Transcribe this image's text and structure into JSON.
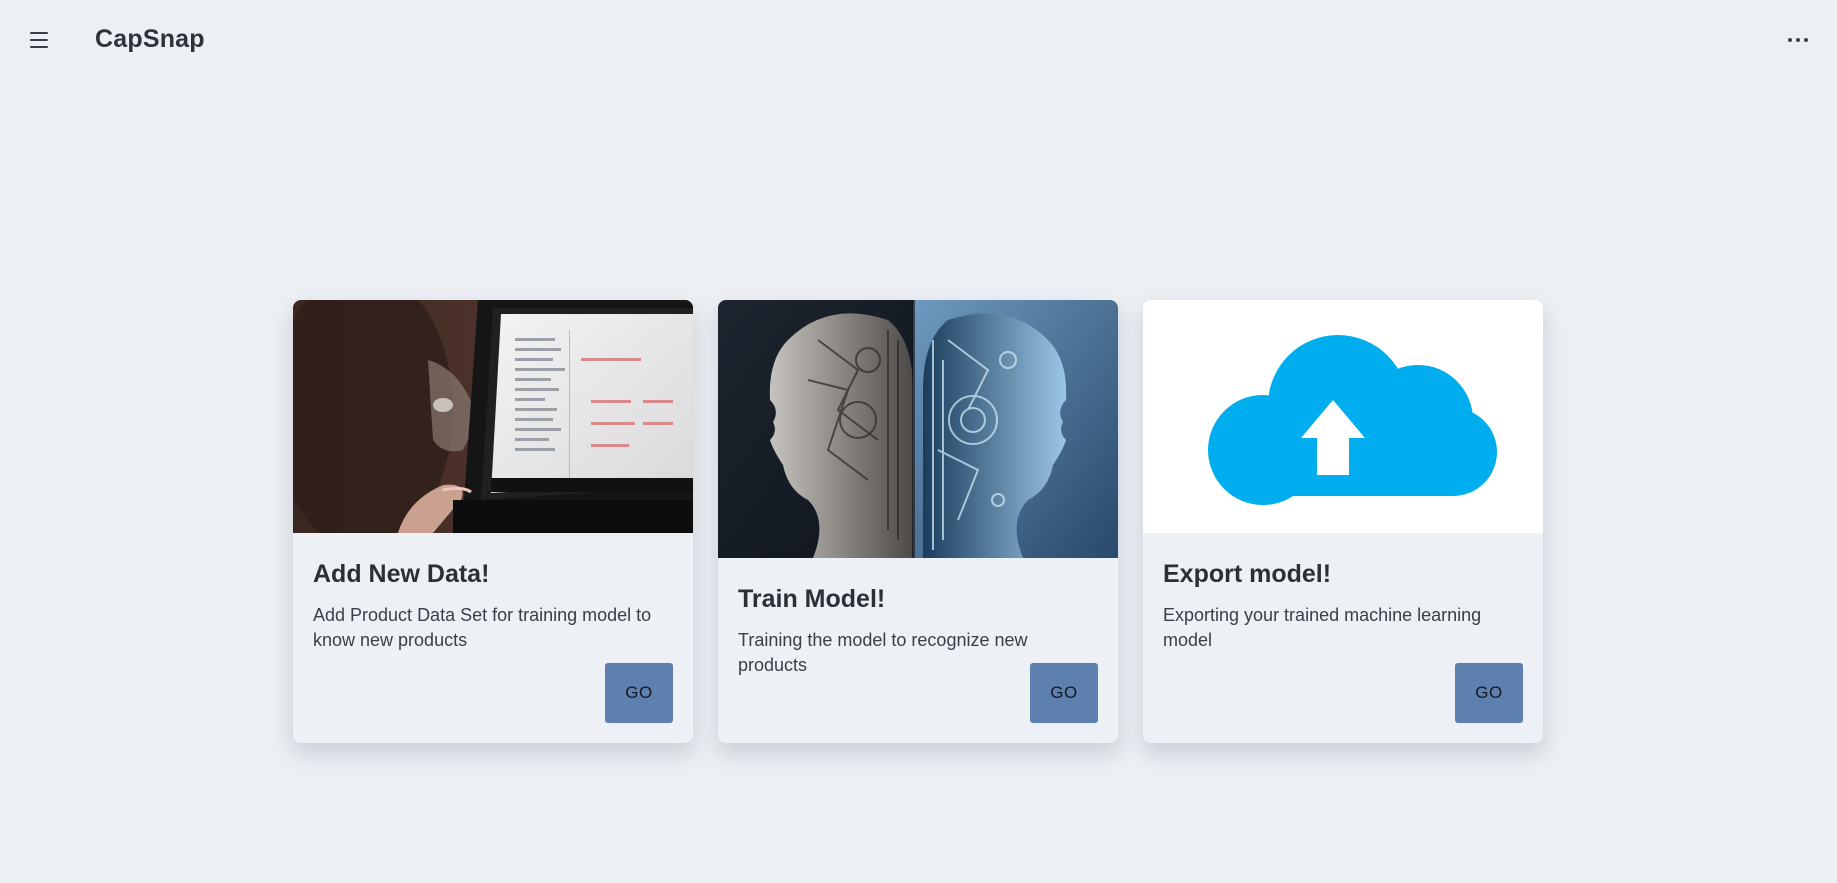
{
  "app": {
    "title": "CapSnap"
  },
  "header": {
    "menu_icon": "hamburger-menu-icon",
    "more_icon": "more-horizontal-icon"
  },
  "cards": [
    {
      "title": "Add New Data!",
      "description": "Add Product Data Set for training model to know new products",
      "button_label": "GO",
      "image": "person-using-laptop-photo"
    },
    {
      "title": "Train Model!",
      "description": "Training the model to recognize new products",
      "button_label": "GO",
      "image": "ai-robot-heads-illustration"
    },
    {
      "title": "Export model!",
      "description": "Exporting your trained machine learning model",
      "button_label": "GO",
      "image": "cloud-upload-icon"
    }
  ],
  "colors": {
    "background": "#eceff4",
    "card_background": "#edf0f5",
    "button": "#5e80ae",
    "cloud": "#00aeef"
  }
}
